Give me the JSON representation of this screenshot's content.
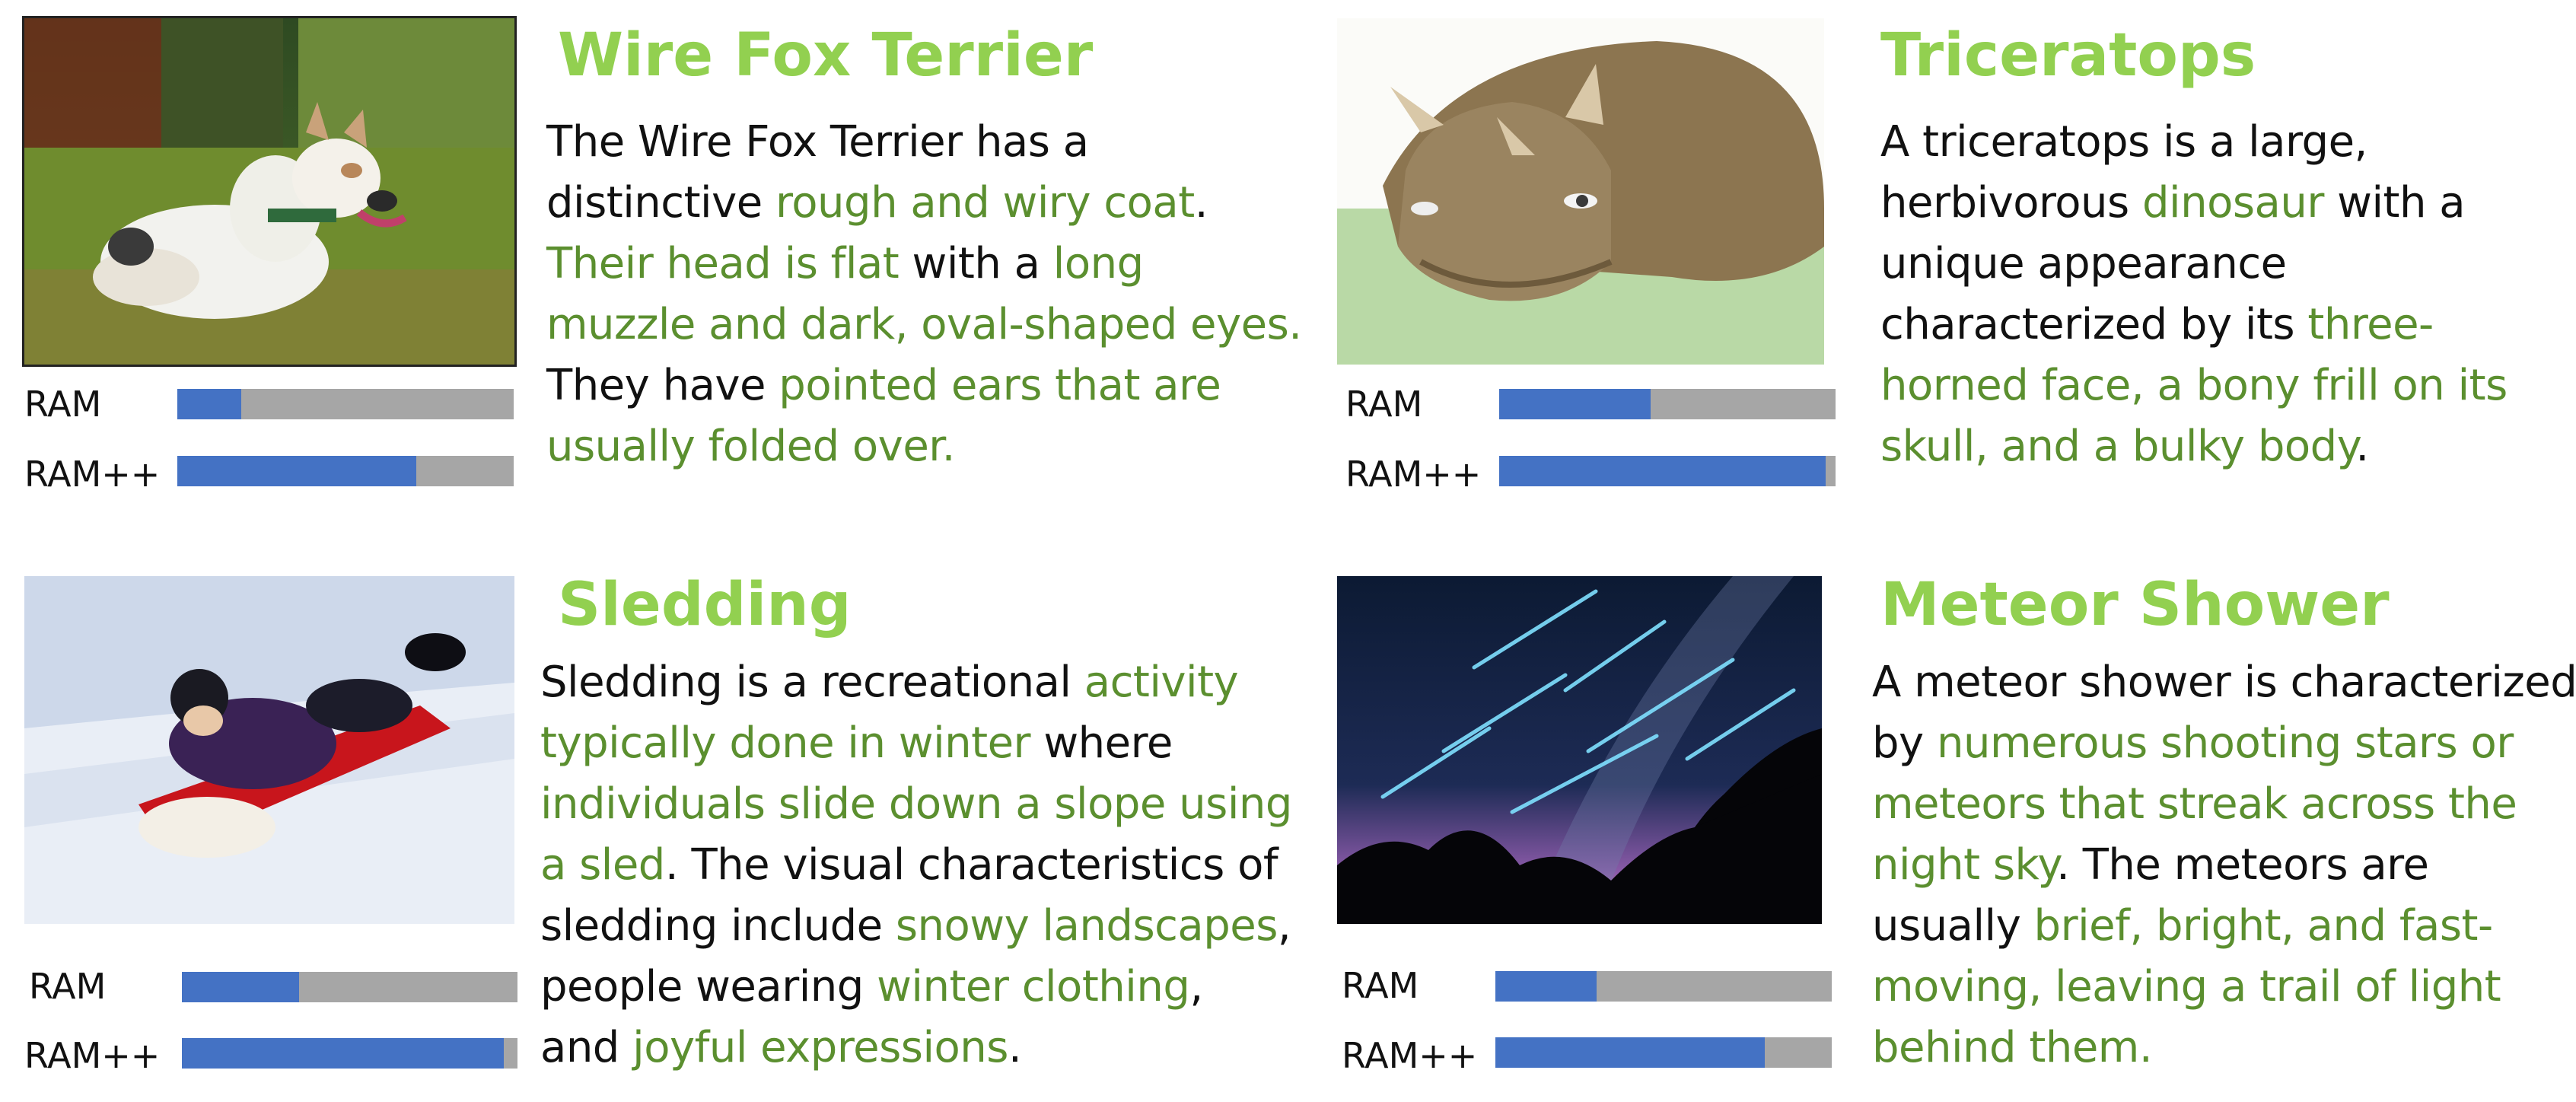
{
  "colors": {
    "title": "#92d050",
    "highlight": "#5b8f2f",
    "bar_fill": "#4472c4",
    "bar_track": "#a6a6a6"
  },
  "bar_labels": {
    "ram": "RAM",
    "ram_pp": "RAM++"
  },
  "cards": [
    {
      "id": "wire-fox-terrier",
      "title": "Wire Fox Terrier",
      "photo": "terrier-photo",
      "scores": {
        "ram": 0.19,
        "ram_pp": 0.71
      },
      "lines": [
        [
          {
            "t": "The Wire Fox Terrier has a",
            "h": false
          }
        ],
        [
          {
            "t": "distinctive ",
            "h": false
          },
          {
            "t": "rough and wiry coat",
            "h": true
          },
          {
            "t": ".",
            "h": false
          }
        ],
        [
          {
            "t": "Their head is flat",
            "h": true
          },
          {
            "t": " with a ",
            "h": false
          },
          {
            "t": "long",
            "h": true
          }
        ],
        [
          {
            "t": "muzzle and dark, oval-shaped eyes.",
            "h": true
          }
        ],
        [
          {
            "t": "They have ",
            "h": false
          },
          {
            "t": "pointed ears that are",
            "h": true
          }
        ],
        [
          {
            "t": "usually folded over.",
            "h": true
          }
        ]
      ]
    },
    {
      "id": "triceratops",
      "title": "Triceratops",
      "photo": "triceratops-photo",
      "scores": {
        "ram": 0.45,
        "ram_pp": 0.97
      },
      "lines": [
        [
          {
            "t": "A triceratops is a large,",
            "h": false
          }
        ],
        [
          {
            "t": "herbivorous ",
            "h": false
          },
          {
            "t": "dinosaur",
            "h": true
          },
          {
            "t": " with a",
            "h": false
          }
        ],
        [
          {
            "t": "unique appearance",
            "h": false
          }
        ],
        [
          {
            "t": "characterized by its ",
            "h": false
          },
          {
            "t": "three-",
            "h": true
          }
        ],
        [
          {
            "t": "horned face, a bony frill on its",
            "h": true
          }
        ],
        [
          {
            "t": "skull, and a bulky body",
            "h": true
          },
          {
            "t": ".",
            "h": false
          }
        ]
      ]
    },
    {
      "id": "sledding",
      "title": "Sledding",
      "photo": "sledding-photo",
      "scores": {
        "ram": 0.35,
        "ram_pp": 0.96
      },
      "lines": [
        [
          {
            "t": "Sledding is a recreational ",
            "h": false
          },
          {
            "t": "activity",
            "h": true
          }
        ],
        [
          {
            "t": "typically done in winter",
            "h": true
          },
          {
            "t": " where",
            "h": false
          }
        ],
        [
          {
            "t": "individuals slide down a slope using",
            "h": true
          }
        ],
        [
          {
            "t": "a sled",
            "h": true
          },
          {
            "t": ". The visual characteristics of",
            "h": false
          }
        ],
        [
          {
            "t": "sledding include ",
            "h": false
          },
          {
            "t": "snowy landscapes",
            "h": true
          },
          {
            "t": ",",
            "h": false
          }
        ],
        [
          {
            "t": "people wearing ",
            "h": false
          },
          {
            "t": "winter clothing",
            "h": true
          },
          {
            "t": ",",
            "h": false
          }
        ],
        [
          {
            "t": "and ",
            "h": false
          },
          {
            "t": "joyful expressions",
            "h": true
          },
          {
            "t": ".",
            "h": false
          }
        ]
      ]
    },
    {
      "id": "meteor-shower",
      "title": "Meteor Shower",
      "photo": "meteor-photo",
      "scores": {
        "ram": 0.3,
        "ram_pp": 0.8
      },
      "lines": [
        [
          {
            "t": "A meteor shower is characterized",
            "h": false
          }
        ],
        [
          {
            "t": "by ",
            "h": false
          },
          {
            "t": "numerous shooting stars or",
            "h": true
          }
        ],
        [
          {
            "t": "meteors that streak across the",
            "h": true
          }
        ],
        [
          {
            "t": "night sky",
            "h": true
          },
          {
            "t": ". The meteors are",
            "h": false
          }
        ],
        [
          {
            "t": "usually ",
            "h": false
          },
          {
            "t": "brief, bright, and fast-",
            "h": true
          }
        ],
        [
          {
            "t": "moving, leaving a trail of light",
            "h": true
          }
        ],
        [
          {
            "t": "behind them.",
            "h": true
          }
        ]
      ]
    }
  ]
}
